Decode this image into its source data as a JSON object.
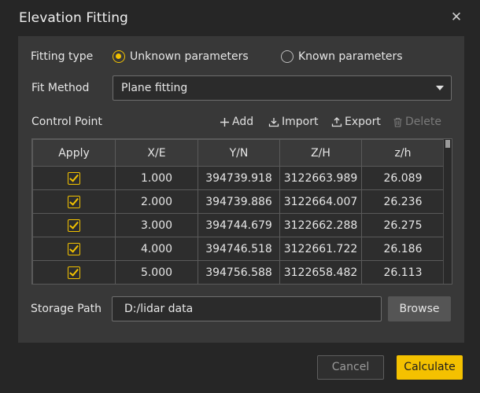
{
  "dialog": {
    "title": "Elevation Fitting",
    "close_icon": "close-icon"
  },
  "fitting_type": {
    "label": "Fitting type",
    "options": [
      {
        "label": "Unknown parameters",
        "selected": true
      },
      {
        "label": "Known parameters",
        "selected": false
      }
    ]
  },
  "fit_method": {
    "label": "Fit Method",
    "value": "Plane fitting"
  },
  "control_point": {
    "label": "Control Point",
    "toolbar": {
      "add": "Add",
      "import": "Import",
      "export": "Export",
      "delete": "Delete"
    },
    "columns": [
      "Apply",
      "X/E",
      "Y/N",
      "Z/H",
      "z/h"
    ],
    "rows": [
      {
        "apply": true,
        "x": "1.000",
        "y": "394739.918",
        "z": "3122663.989",
        "h": "26.089"
      },
      {
        "apply": true,
        "x": "2.000",
        "y": "394739.886",
        "z": "3122664.007",
        "h": "26.236"
      },
      {
        "apply": true,
        "x": "3.000",
        "y": "394744.679",
        "z": "3122662.288",
        "h": "26.275"
      },
      {
        "apply": true,
        "x": "4.000",
        "y": "394746.518",
        "z": "3122661.722",
        "h": "26.186"
      },
      {
        "apply": true,
        "x": "5.000",
        "y": "394756.588",
        "z": "3122658.482",
        "h": "26.113"
      }
    ]
  },
  "storage": {
    "label": "Storage Path",
    "value": "D:/lidar data",
    "browse_label": "Browse"
  },
  "footer": {
    "cancel_label": "Cancel",
    "calculate_label": "Calculate"
  },
  "colors": {
    "accent": "#f4c100",
    "background": "#262626",
    "panel": "#383838"
  }
}
